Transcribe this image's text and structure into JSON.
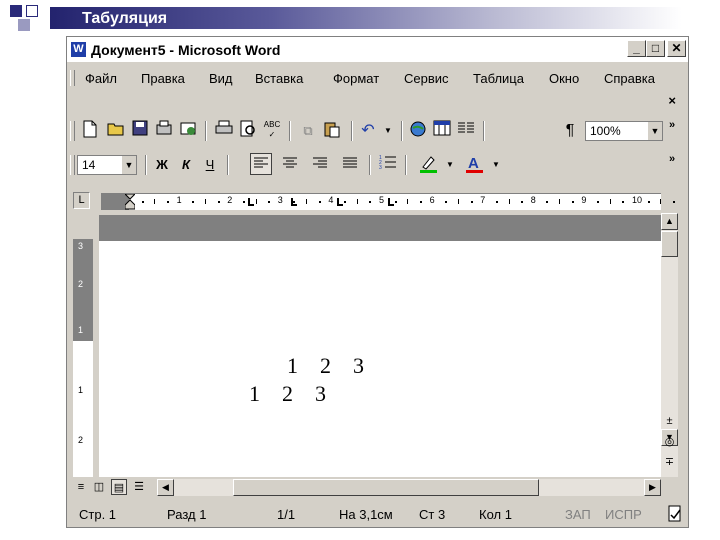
{
  "slide": {
    "title": "Табуляция"
  },
  "window": {
    "title": "Документ5 - Microsoft Word",
    "min_label": "_",
    "max_label": "□",
    "close_label": "✕"
  },
  "menu": {
    "items": [
      "Файл",
      "Правка",
      "Вид",
      "Вставка",
      "Формат",
      "Сервис",
      "Таблица",
      "Окно",
      "Справка"
    ],
    "close_doc": "×"
  },
  "toolbar_standard": {
    "zoom": "100%",
    "more": "»"
  },
  "toolbar_formatting": {
    "font_size": "14",
    "bold": "Ж",
    "italic": "К",
    "underline": "Ч",
    "more": "»",
    "highlight_color": "#00c000",
    "font_color": "#e00000"
  },
  "ruler": {
    "numbers": [
      "1",
      "2",
      "3",
      "4",
      "5",
      "6",
      "7",
      "8",
      "9",
      "10"
    ],
    "tab_selector": "L"
  },
  "vruler": {
    "numbers": [
      "3",
      "2",
      "1",
      "1",
      "2"
    ]
  },
  "document": {
    "lines": [
      {
        "text": "1    2    3"
      },
      {
        "text": "1    2    3"
      }
    ]
  },
  "status": {
    "page": "Стр. 1",
    "section": "Разд 1",
    "pages": "1/1",
    "position": "На 3,1см",
    "line": "Ст 3",
    "column": "Кол 1",
    "rec": "ЗАП",
    "trk": "ИСПР"
  }
}
